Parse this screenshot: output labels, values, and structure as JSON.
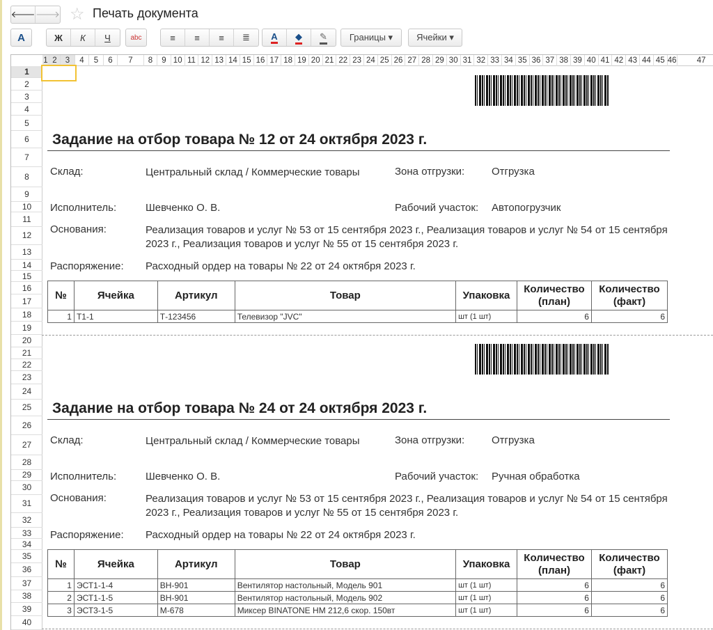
{
  "window": {
    "title": "Печать документа"
  },
  "toolbar": {
    "font": "A",
    "bold": "Ж",
    "italic": "К",
    "underline": "Ч",
    "spell": "abc",
    "borders": "Границы ▾",
    "cells": "Ячейки ▾"
  },
  "columns": [
    "1",
    "2",
    "3",
    "4",
    "5",
    "6",
    "7",
    "8",
    "9",
    "10",
    "11",
    "12",
    "13",
    "14",
    "15",
    "16",
    "17",
    "18",
    "19",
    "20",
    "21",
    "22",
    "23",
    "24",
    "25",
    "26",
    "27",
    "28",
    "29",
    "30",
    "31",
    "32",
    "33",
    "34",
    "35",
    "36",
    "37",
    "38",
    "39",
    "40",
    "41",
    "42",
    "43",
    "44",
    "45",
    "46",
    "47"
  ],
  "rows": [
    "1",
    "2",
    "3",
    "4",
    "5",
    "6",
    "7",
    "8",
    "9",
    "10",
    "11",
    "12",
    "13",
    "14",
    "15",
    "16",
    "17",
    "18",
    "19",
    "20",
    "21",
    "22",
    "23",
    "24",
    "25",
    "26",
    "27",
    "28",
    "29",
    "30",
    "31",
    "32",
    "33",
    "34",
    "35",
    "36",
    "37",
    "38",
    "39",
    "40"
  ],
  "table_headers": [
    "№",
    "Ячейка",
    "Артикул",
    "Товар",
    "Упаковка",
    "Количество (план)",
    "Количество (факт)"
  ],
  "docs": [
    {
      "title": "Задание на отбор товара № 12 от 24 октября 2023 г.",
      "warehouse_label": "Склад:",
      "warehouse": "Центральный склад / Коммерческие товары",
      "zone_label": "Зона отгрузки:",
      "zone": "Отгрузка",
      "executor_label": "Исполнитель:",
      "executor": "Шевченко О. В.",
      "area_label": "Рабочий участок:",
      "area": "Автопогрузчик",
      "basis_label": "Основания:",
      "basis": "Реализация товаров и услуг № 53 от 15 сентября 2023 г., Реализация товаров и услуг № 54 от 15 сентября 2023 г., Реализация товаров и услуг № 55 от 15 сентября 2023 г.",
      "order_label": "Распоряжение:",
      "order": "Расходный ордер на товары № 22 от 24 октября 2023 г.",
      "items": [
        [
          "1",
          "Т1-1",
          "Т-123456",
          "Телевизор \"JVC\"",
          "шт (1 шт)",
          "6",
          "6"
        ]
      ]
    },
    {
      "title": "Задание на отбор товара № 24 от 24 октября 2023 г.",
      "warehouse_label": "Склад:",
      "warehouse": "Центральный склад / Коммерческие товары",
      "zone_label": "Зона отгрузки:",
      "zone": "Отгрузка",
      "executor_label": "Исполнитель:",
      "executor": "Шевченко О. В.",
      "area_label": "Рабочий участок:",
      "area": "Ручная обработка",
      "basis_label": "Основания:",
      "basis": "Реализация товаров и услуг № 53 от 15 сентября 2023 г., Реализация товаров и услуг № 54 от 15 сентября 2023 г., Реализация товаров и услуг № 55 от 15 сентября 2023 г.",
      "order_label": "Распоряжение:",
      "order": "Расходный ордер на товары № 22 от 24 октября 2023 г.",
      "items": [
        [
          "1",
          "ЭСТ1-1-4",
          "ВН-901",
          "Вентилятор настольный, Модель 901",
          "шт (1 шт)",
          "6",
          "6"
        ],
        [
          "2",
          "ЭСТ1-1-5",
          "ВН-901",
          "Вентилятор настольный, Модель 902",
          "шт (1 шт)",
          "6",
          "6"
        ],
        [
          "3",
          "ЭСТ3-1-5",
          "М-678",
          "Миксер BINATONE HM 212,6 скор. 150вт",
          "шт (1 шт)",
          "6",
          "6"
        ]
      ]
    }
  ]
}
